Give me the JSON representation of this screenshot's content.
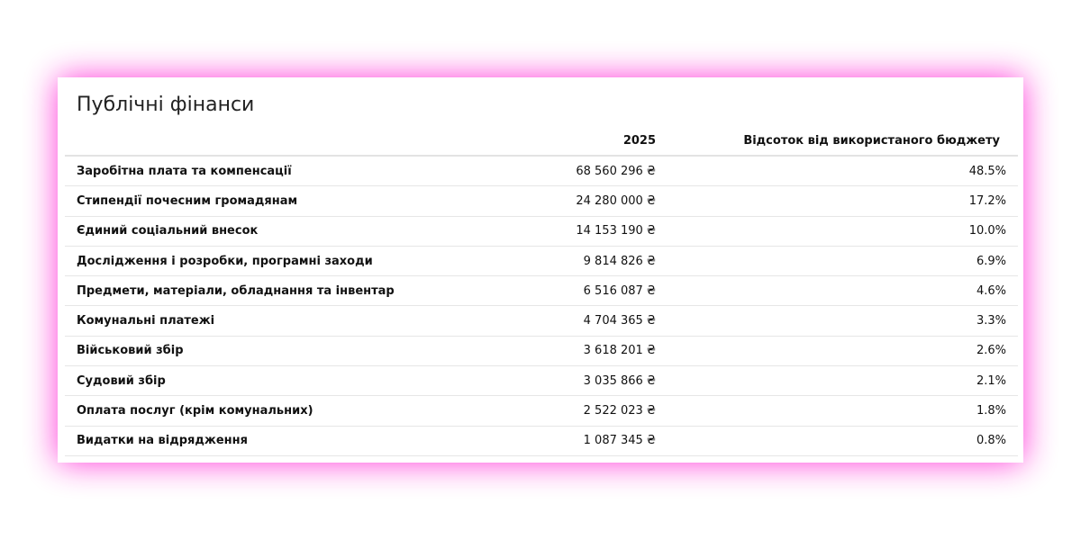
{
  "title": "Публічні фінанси",
  "columns": {
    "name": "",
    "year": "2025",
    "percent": "Відсоток від використаного бюджету"
  },
  "rows": [
    {
      "name": "Заробітна плата та компенсації",
      "amount": "68 560 296 ₴",
      "percent": "48.5%"
    },
    {
      "name": "Стипендії почесним громадянам",
      "amount": "24 280 000 ₴",
      "percent": "17.2%"
    },
    {
      "name": "Єдиний соціальний внесок",
      "amount": "14 153 190 ₴",
      "percent": "10.0%"
    },
    {
      "name": "Дослідження і розробки, програмні заходи",
      "amount": "9 814 826 ₴",
      "percent": "6.9%"
    },
    {
      "name": "Предмети, матеріали, обладнання та інвентар",
      "amount": "6 516 087 ₴",
      "percent": "4.6%"
    },
    {
      "name": "Комунальні платежі",
      "amount": "4 704 365 ₴",
      "percent": "3.3%"
    },
    {
      "name": "Військовий збір",
      "amount": "3 618 201 ₴",
      "percent": "2.6%"
    },
    {
      "name": "Судовий збір",
      "amount": "3 035 866 ₴",
      "percent": "2.1%"
    },
    {
      "name": "Оплата послуг (крім комунальних)",
      "amount": "2 522 023 ₴",
      "percent": "1.8%"
    },
    {
      "name": "Видатки на відрядження",
      "amount": "1 087 345 ₴",
      "percent": "0.8%"
    }
  ]
}
